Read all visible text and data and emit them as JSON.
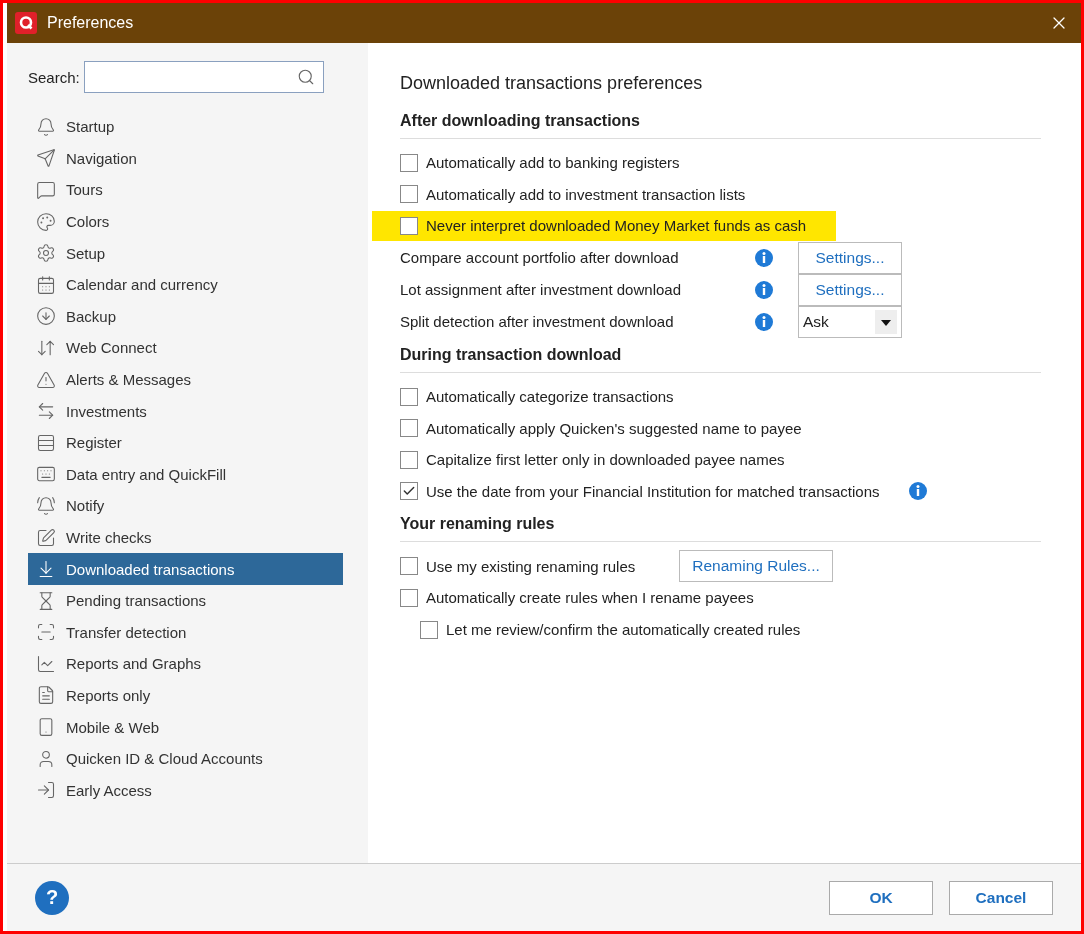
{
  "window": {
    "title": "Preferences"
  },
  "search": {
    "label": "Search:"
  },
  "sidebar": {
    "items": [
      {
        "label": "Startup",
        "selected": false
      },
      {
        "label": "Navigation",
        "selected": false
      },
      {
        "label": "Tours",
        "selected": false
      },
      {
        "label": "Colors",
        "selected": false
      },
      {
        "label": "Setup",
        "selected": false
      },
      {
        "label": "Calendar and currency",
        "selected": false
      },
      {
        "label": "Backup",
        "selected": false
      },
      {
        "label": "Web Connect",
        "selected": false
      },
      {
        "label": "Alerts & Messages",
        "selected": false
      },
      {
        "label": "Investments",
        "selected": false
      },
      {
        "label": "Register",
        "selected": false
      },
      {
        "label": "Data entry and QuickFill",
        "selected": false
      },
      {
        "label": "Notify",
        "selected": false
      },
      {
        "label": "Write checks",
        "selected": false
      },
      {
        "label": "Downloaded transactions",
        "selected": true
      },
      {
        "label": "Pending transactions",
        "selected": false
      },
      {
        "label": "Transfer detection",
        "selected": false
      },
      {
        "label": "Reports and Graphs",
        "selected": false
      },
      {
        "label": "Reports only",
        "selected": false
      },
      {
        "label": "Mobile & Web",
        "selected": false
      },
      {
        "label": "Quicken ID & Cloud Accounts",
        "selected": false
      },
      {
        "label": "Early Access",
        "selected": false
      }
    ]
  },
  "content": {
    "title": "Downloaded transactions preferences",
    "sections": [
      {
        "heading": "After downloading transactions",
        "rows": [
          {
            "kind": "checkbox",
            "label": "Automatically add to banking registers",
            "checked": false,
            "highlighted": false
          },
          {
            "kind": "checkbox",
            "label": "Automatically add to investment transaction lists",
            "checked": false,
            "highlighted": false
          },
          {
            "kind": "checkbox",
            "label": "Never interpret downloaded Money Market funds as cash",
            "checked": false,
            "highlighted": true
          },
          {
            "kind": "button",
            "label": "Compare account portfolio after download",
            "button": "Settings..."
          },
          {
            "kind": "button",
            "label": "Lot assignment after investment download",
            "button": "Settings..."
          },
          {
            "kind": "select",
            "label": "Split detection after investment download",
            "value": "Ask"
          }
        ]
      },
      {
        "heading": "During transaction download",
        "rows": [
          {
            "kind": "checkbox",
            "label": "Automatically categorize transactions",
            "checked": false,
            "highlighted": false
          },
          {
            "kind": "checkbox",
            "label": "Automatically apply Quicken's suggested name to payee",
            "checked": false,
            "highlighted": false
          },
          {
            "kind": "checkbox",
            "label": "Capitalize first letter only in downloaded payee names",
            "checked": false,
            "highlighted": false
          },
          {
            "kind": "checkbox",
            "label": "Use the date from your Financial Institution for matched transactions",
            "checked": true,
            "highlighted": false,
            "info": true
          }
        ]
      },
      {
        "heading": "Your renaming rules",
        "rows": [
          {
            "kind": "checkbox",
            "label": "Use my existing renaming rules",
            "checked": false,
            "highlighted": false,
            "button": "Renaming Rules..."
          },
          {
            "kind": "checkbox",
            "label": "Automatically create rules when I rename payees",
            "checked": false,
            "highlighted": false,
            "children": [
              {
                "kind": "checkbox",
                "label": "Let me review/confirm the automatically created rules",
                "checked": false,
                "highlighted": false
              }
            ]
          }
        ]
      }
    ]
  },
  "footer": {
    "help": "?",
    "buttons": [
      "OK",
      "Cancel"
    ]
  }
}
